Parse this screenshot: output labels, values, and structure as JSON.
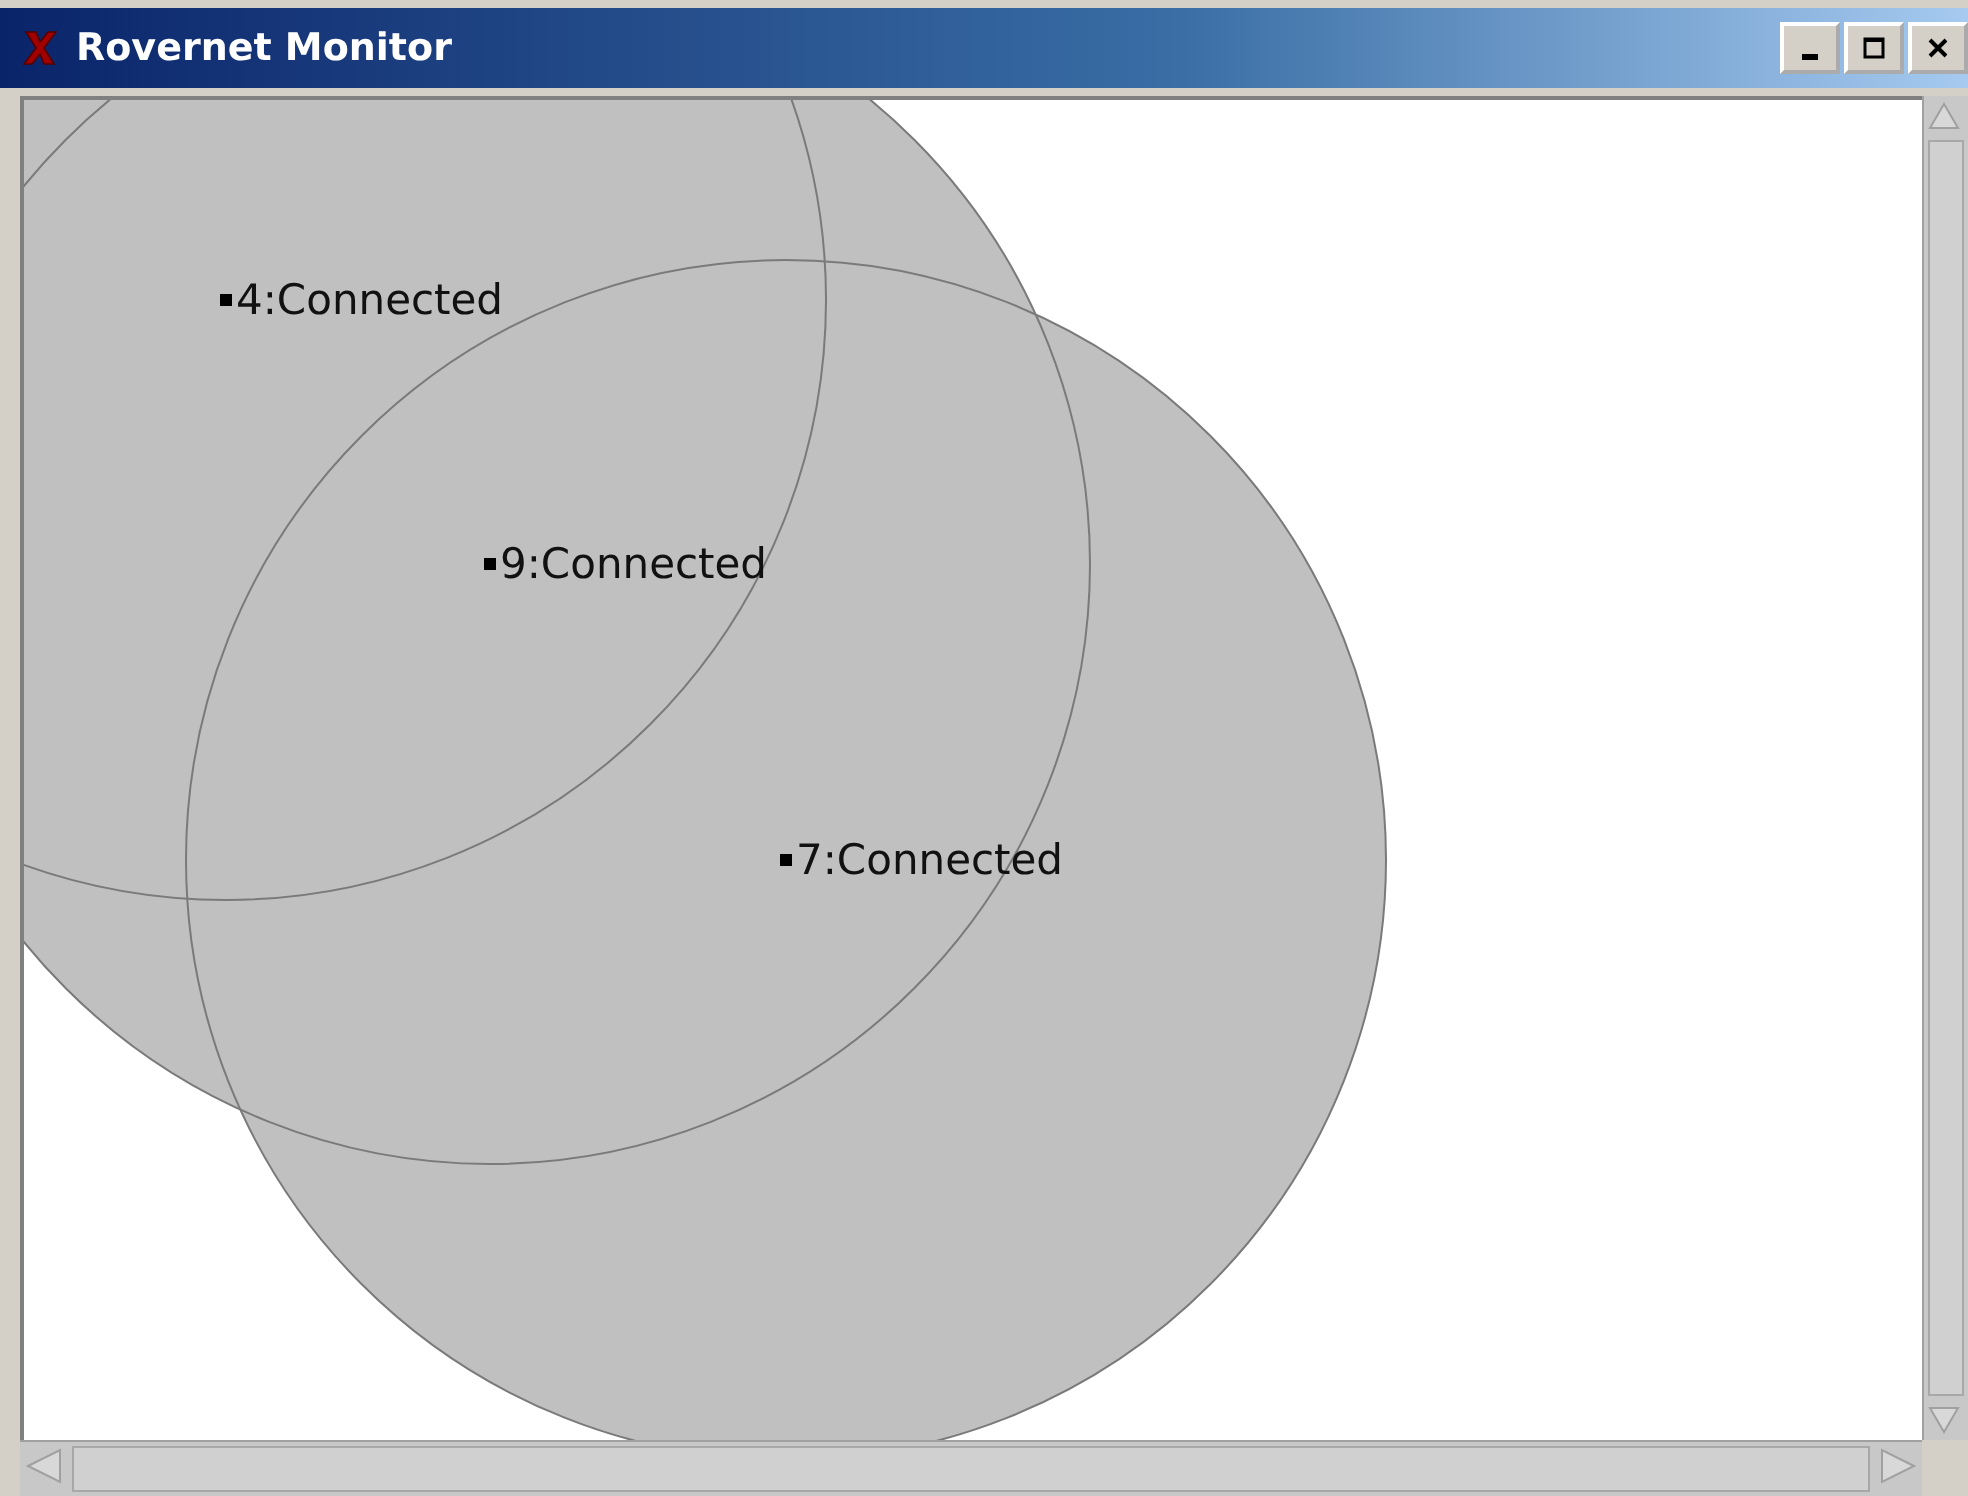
{
  "window": {
    "title": "Rovernet Monitor"
  },
  "nodes": [
    {
      "label": "4:Connected"
    },
    {
      "label": "9:Connected"
    },
    {
      "label": "7:Connected"
    }
  ]
}
